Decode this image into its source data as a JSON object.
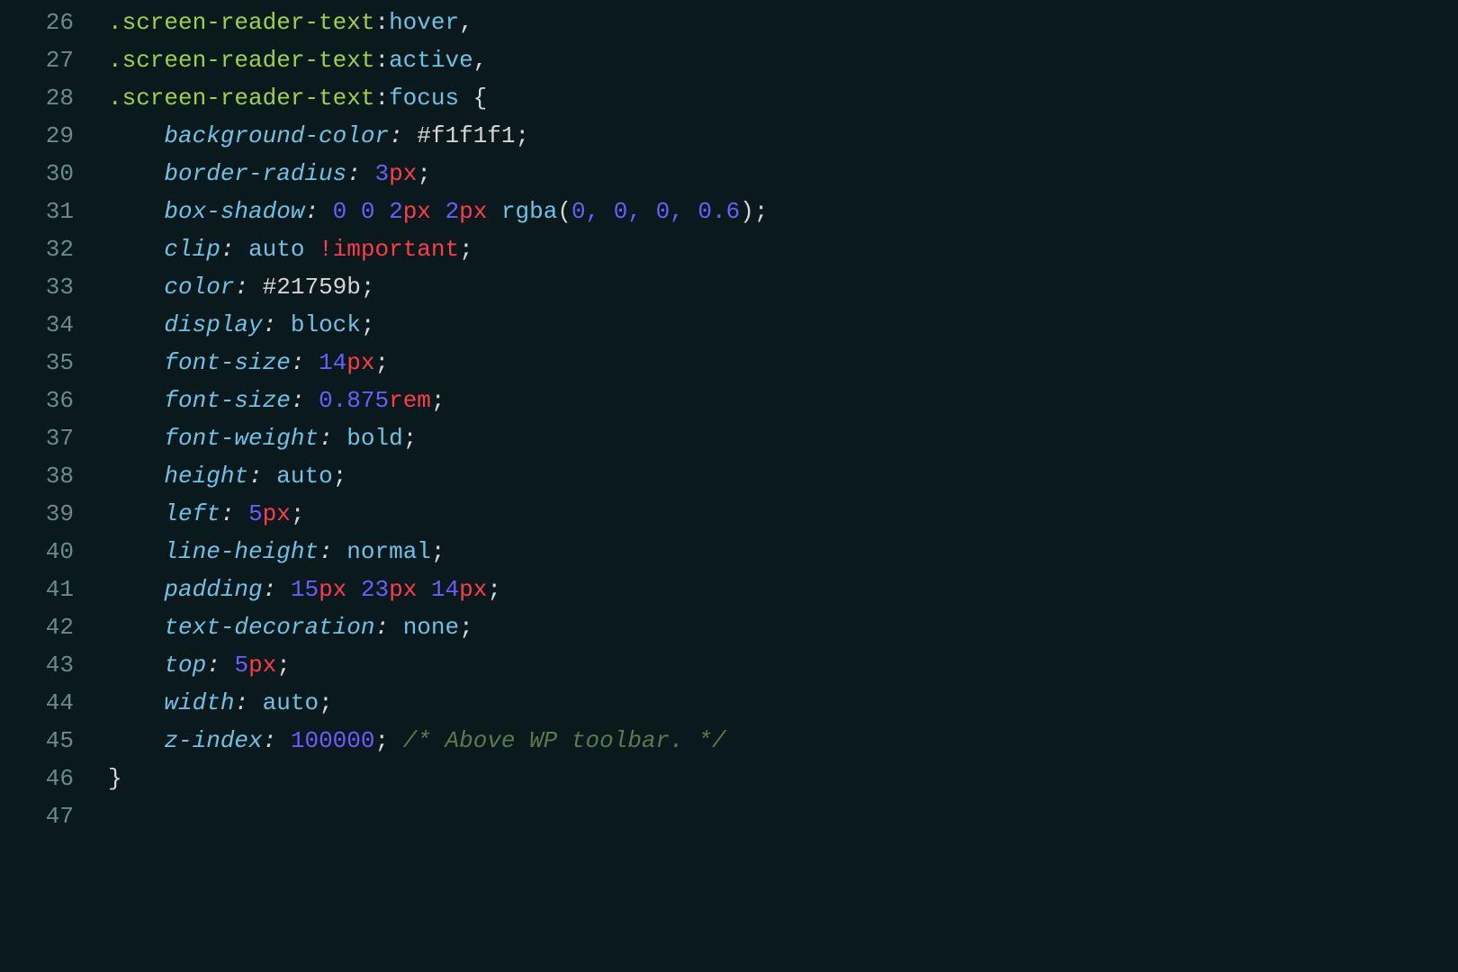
{
  "lines": [
    {
      "num": "26",
      "indent": "",
      "tokens": [
        {
          "cls": "t-selector",
          "text": ".screen-reader-text"
        },
        {
          "cls": "t-punct",
          "text": ":"
        },
        {
          "cls": "t-pseudo",
          "text": "hover"
        },
        {
          "cls": "t-comma",
          "text": ","
        }
      ]
    },
    {
      "num": "27",
      "indent": "",
      "tokens": [
        {
          "cls": "t-selector",
          "text": ".screen-reader-text"
        },
        {
          "cls": "t-punct",
          "text": ":"
        },
        {
          "cls": "t-pseudo",
          "text": "active"
        },
        {
          "cls": "t-comma",
          "text": ","
        }
      ]
    },
    {
      "num": "28",
      "indent": "",
      "tokens": [
        {
          "cls": "t-selector",
          "text": ".screen-reader-text"
        },
        {
          "cls": "t-punct",
          "text": ":"
        },
        {
          "cls": "t-pseudo",
          "text": "focus"
        },
        {
          "cls": "t-brace",
          "text": " {"
        }
      ]
    },
    {
      "num": "29",
      "indent": "    ",
      "tokens": [
        {
          "cls": "t-prop",
          "text": "background-color"
        },
        {
          "cls": "t-colon",
          "text": ": "
        },
        {
          "cls": "t-hex",
          "text": "#f1f1f1"
        },
        {
          "cls": "t-semi",
          "text": ";"
        }
      ]
    },
    {
      "num": "30",
      "indent": "    ",
      "tokens": [
        {
          "cls": "t-prop",
          "text": "border-radius"
        },
        {
          "cls": "t-colon",
          "text": ": "
        },
        {
          "cls": "t-num",
          "text": "3"
        },
        {
          "cls": "t-unit",
          "text": "px"
        },
        {
          "cls": "t-semi",
          "text": ";"
        }
      ]
    },
    {
      "num": "31",
      "indent": "    ",
      "tokens": [
        {
          "cls": "t-prop",
          "text": "box-shadow"
        },
        {
          "cls": "t-colon",
          "text": ": "
        },
        {
          "cls": "t-num",
          "text": "0 0 2"
        },
        {
          "cls": "t-unit",
          "text": "px"
        },
        {
          "cls": "t-num",
          "text": " 2"
        },
        {
          "cls": "t-unit",
          "text": "px"
        },
        {
          "cls": "t-func",
          "text": " rgba"
        },
        {
          "cls": "t-punct",
          "text": "("
        },
        {
          "cls": "t-num",
          "text": "0, 0, 0, 0.6"
        },
        {
          "cls": "t-punct",
          "text": ")"
        },
        {
          "cls": "t-semi",
          "text": ";"
        }
      ]
    },
    {
      "num": "32",
      "indent": "    ",
      "tokens": [
        {
          "cls": "t-prop",
          "text": "clip"
        },
        {
          "cls": "t-colon",
          "text": ": "
        },
        {
          "cls": "t-value",
          "text": "auto "
        },
        {
          "cls": "t-important",
          "text": "!important"
        },
        {
          "cls": "t-semi",
          "text": ";"
        }
      ]
    },
    {
      "num": "33",
      "indent": "    ",
      "tokens": [
        {
          "cls": "t-prop",
          "text": "color"
        },
        {
          "cls": "t-colon",
          "text": ": "
        },
        {
          "cls": "t-hex",
          "text": "#21759b"
        },
        {
          "cls": "t-semi",
          "text": ";"
        }
      ]
    },
    {
      "num": "34",
      "indent": "    ",
      "tokens": [
        {
          "cls": "t-prop",
          "text": "display"
        },
        {
          "cls": "t-colon",
          "text": ": "
        },
        {
          "cls": "t-value",
          "text": "block"
        },
        {
          "cls": "t-semi",
          "text": ";"
        }
      ]
    },
    {
      "num": "35",
      "indent": "    ",
      "tokens": [
        {
          "cls": "t-prop",
          "text": "font-size"
        },
        {
          "cls": "t-colon",
          "text": ": "
        },
        {
          "cls": "t-num",
          "text": "14"
        },
        {
          "cls": "t-unit",
          "text": "px"
        },
        {
          "cls": "t-semi",
          "text": ";"
        }
      ]
    },
    {
      "num": "36",
      "indent": "    ",
      "tokens": [
        {
          "cls": "t-prop",
          "text": "font-size"
        },
        {
          "cls": "t-colon",
          "text": ": "
        },
        {
          "cls": "t-num",
          "text": "0.875"
        },
        {
          "cls": "t-unit",
          "text": "rem"
        },
        {
          "cls": "t-semi",
          "text": ";"
        }
      ]
    },
    {
      "num": "37",
      "indent": "    ",
      "tokens": [
        {
          "cls": "t-prop",
          "text": "font-weight"
        },
        {
          "cls": "t-colon",
          "text": ": "
        },
        {
          "cls": "t-value",
          "text": "bold"
        },
        {
          "cls": "t-semi",
          "text": ";"
        }
      ]
    },
    {
      "num": "38",
      "indent": "    ",
      "tokens": [
        {
          "cls": "t-prop",
          "text": "height"
        },
        {
          "cls": "t-colon",
          "text": ": "
        },
        {
          "cls": "t-value",
          "text": "auto"
        },
        {
          "cls": "t-semi",
          "text": ";"
        }
      ]
    },
    {
      "num": "39",
      "indent": "    ",
      "tokens": [
        {
          "cls": "t-prop",
          "text": "left"
        },
        {
          "cls": "t-colon",
          "text": ": "
        },
        {
          "cls": "t-num",
          "text": "5"
        },
        {
          "cls": "t-unit",
          "text": "px"
        },
        {
          "cls": "t-semi",
          "text": ";"
        }
      ]
    },
    {
      "num": "40",
      "indent": "    ",
      "tokens": [
        {
          "cls": "t-prop",
          "text": "line-height"
        },
        {
          "cls": "t-colon",
          "text": ": "
        },
        {
          "cls": "t-value",
          "text": "normal"
        },
        {
          "cls": "t-semi",
          "text": ";"
        }
      ]
    },
    {
      "num": "41",
      "indent": "    ",
      "tokens": [
        {
          "cls": "t-prop",
          "text": "padding"
        },
        {
          "cls": "t-colon",
          "text": ": "
        },
        {
          "cls": "t-num",
          "text": "15"
        },
        {
          "cls": "t-unit",
          "text": "px"
        },
        {
          "cls": "t-num",
          "text": " 23"
        },
        {
          "cls": "t-unit",
          "text": "px"
        },
        {
          "cls": "t-num",
          "text": " 14"
        },
        {
          "cls": "t-unit",
          "text": "px"
        },
        {
          "cls": "t-semi",
          "text": ";"
        }
      ]
    },
    {
      "num": "42",
      "indent": "    ",
      "tokens": [
        {
          "cls": "t-prop",
          "text": "text-decoration"
        },
        {
          "cls": "t-colon",
          "text": ": "
        },
        {
          "cls": "t-value",
          "text": "none"
        },
        {
          "cls": "t-semi",
          "text": ";"
        }
      ]
    },
    {
      "num": "43",
      "indent": "    ",
      "tokens": [
        {
          "cls": "t-prop",
          "text": "top"
        },
        {
          "cls": "t-colon",
          "text": ": "
        },
        {
          "cls": "t-num",
          "text": "5"
        },
        {
          "cls": "t-unit",
          "text": "px"
        },
        {
          "cls": "t-semi",
          "text": ";"
        }
      ]
    },
    {
      "num": "44",
      "indent": "    ",
      "tokens": [
        {
          "cls": "t-prop",
          "text": "width"
        },
        {
          "cls": "t-colon",
          "text": ": "
        },
        {
          "cls": "t-value",
          "text": "auto"
        },
        {
          "cls": "t-semi",
          "text": ";"
        }
      ]
    },
    {
      "num": "45",
      "indent": "    ",
      "tokens": [
        {
          "cls": "t-prop",
          "text": "z-index"
        },
        {
          "cls": "t-colon",
          "text": ": "
        },
        {
          "cls": "t-num",
          "text": "100000"
        },
        {
          "cls": "t-semi",
          "text": "; "
        },
        {
          "cls": "t-comment",
          "text": "/* Above WP toolbar. */"
        }
      ]
    },
    {
      "num": "46",
      "indent": "",
      "tokens": [
        {
          "cls": "t-brace",
          "text": "}"
        }
      ]
    },
    {
      "num": "47",
      "indent": "",
      "tokens": []
    }
  ]
}
